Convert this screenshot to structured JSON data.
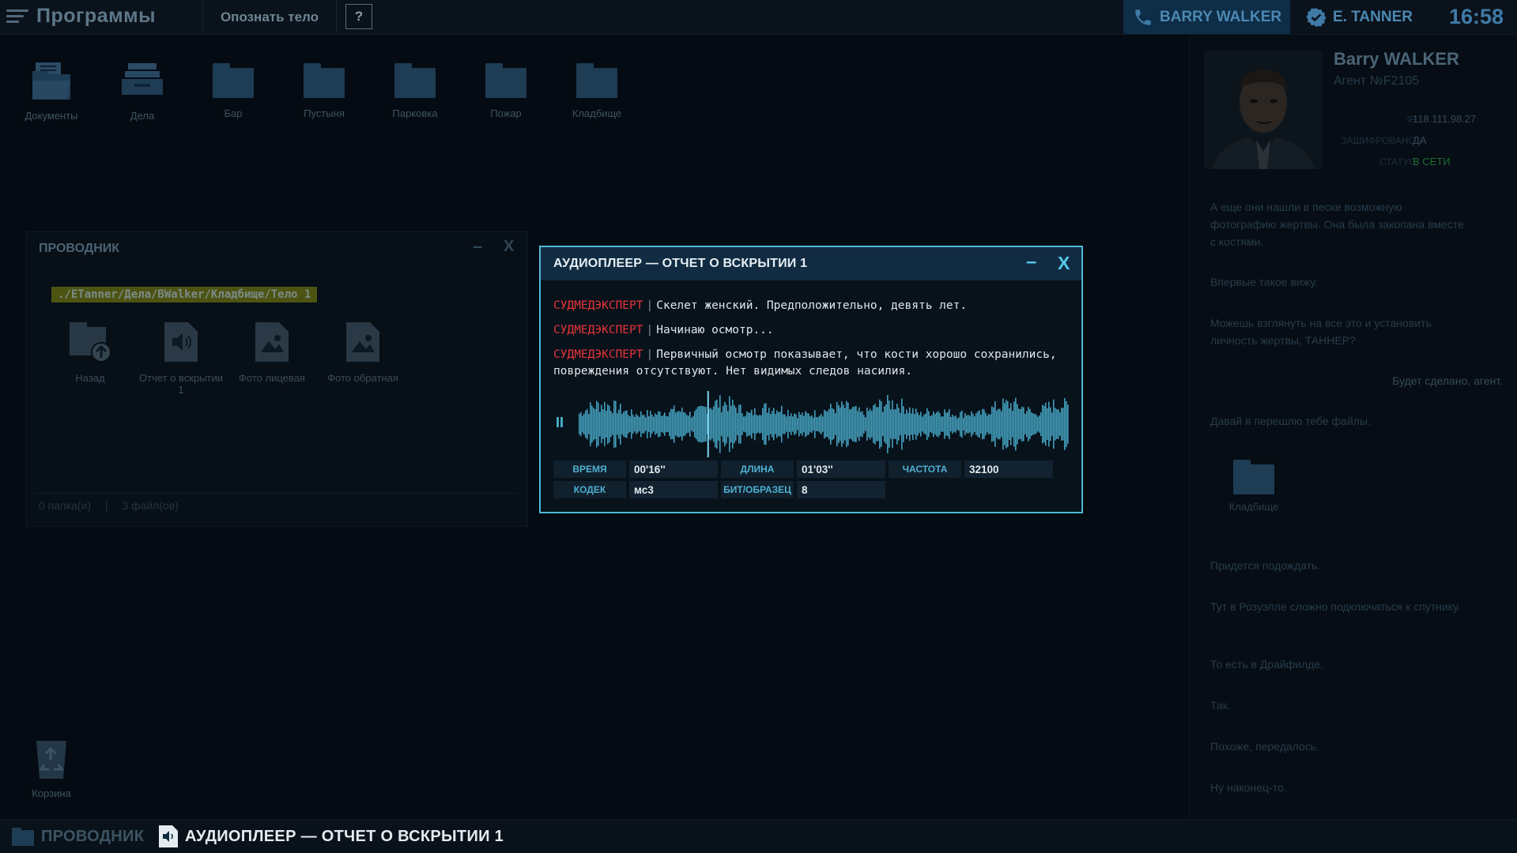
{
  "topbar": {
    "programs": "Программы",
    "identify_tab": "Опознать тело",
    "help": "?",
    "call_name": "BARRY WALKER",
    "agent_name": "E. TANNER",
    "clock": "16:58"
  },
  "desktop": {
    "icons": [
      {
        "label": "Документы",
        "icon": "open-folder-icon"
      },
      {
        "label": "Дела",
        "icon": "file-tray-icon"
      },
      {
        "label": "Бар",
        "icon": "folder-icon"
      },
      {
        "label": "Пустыня",
        "icon": "folder-icon"
      },
      {
        "label": "Парковка",
        "icon": "folder-icon"
      },
      {
        "label": "Пожар",
        "icon": "folder-icon"
      },
      {
        "label": "Кладбище",
        "icon": "folder-icon"
      }
    ],
    "trash": "Корзина"
  },
  "explorer": {
    "title": "ПРОВОДНИК",
    "minimize": "–",
    "close": "X",
    "path": "./ETanner/Дела/BWalker/Кладбище/Тело 1",
    "items": [
      {
        "label": "Назад",
        "icon": "back-folder-icon"
      },
      {
        "label": "Отчет о вскрытии 1",
        "icon": "audio-file-icon"
      },
      {
        "label": "Фото лицевая",
        "icon": "image-file-icon"
      },
      {
        "label": "Фото обратная",
        "icon": "image-file-icon"
      }
    ],
    "status_folders": "0 папка(и)",
    "status_sep": "|",
    "status_files": "3 файл(ов)"
  },
  "player": {
    "title": "АУДИОПЛЕЕР — ОТЧЕТ О ВСКРЫТИИ 1",
    "minimize": "–",
    "close": "X",
    "transcript": [
      {
        "speaker": "СУДМЕДЭКСПЕРТ",
        "text": "Скелет женский. Предположительно, девять лет."
      },
      {
        "speaker": "СУДМЕДЭКСПЕРТ",
        "text": "Начинаю осмотр..."
      },
      {
        "speaker": "СУДМЕДЭКСПЕРТ",
        "text": "Первичный осмотр показывает, что кости хорошо сохранились, повреждения отсутствуют. Нет видимых следов насилия."
      }
    ],
    "separator": "|",
    "pause_symbol": "II",
    "playback_position": 0.264,
    "meta": {
      "time_label": "ВРЕМЯ",
      "time_value": "00'16''",
      "length_label": "ДЛИНА",
      "length_value": "01'03''",
      "freq_label": "ЧАСТОТА",
      "freq_value": "32100",
      "codec_label": "КОДЕК",
      "codec_value": "мс3",
      "bits_label": "БИТ/ОБРАЗЕЦ",
      "bits_value": "8"
    },
    "accent_color": "#4fb9d8",
    "speaker_color": "#e8343a"
  },
  "contact": {
    "name": "Barry WALKER",
    "agent_number": "Агент №F2105",
    "info": [
      {
        "key": "IP",
        "value": "118.111.98.27"
      },
      {
        "key": "ЗАШИФРОВАНО",
        "value": "ДА"
      },
      {
        "key": "СТАТУС",
        "value": "В СЕТИ"
      }
    ],
    "messages": [
      {
        "from": "them",
        "text": "А еще они нашли в песке возможную фотографию жертвы. Она была закопана вместе с костями."
      },
      {
        "from": "them",
        "text": "Впервые такое вижу."
      },
      {
        "from": "them",
        "text": "Можешь взглянуть на все это и установить личность жертвы, ТАННЕР?"
      },
      {
        "from": "me",
        "text": "Будет сделано, агент."
      },
      {
        "from": "them",
        "text": "Давай я перешлю тебе файлы."
      },
      {
        "from": "them",
        "text": "Придется подождать."
      },
      {
        "from": "them",
        "text": "Тут в Розуэлле сложно подключаться к спутнику."
      },
      {
        "from": "them",
        "text": "То есть в Драйфилде."
      },
      {
        "from": "them",
        "text": "Так."
      },
      {
        "from": "them",
        "text": "Похоже, передалось."
      },
      {
        "from": "them",
        "text": "Ну наконец-то."
      }
    ],
    "attachment": "Кладбище",
    "status_online_color": "#2f7f3a"
  },
  "taskbar": {
    "explorer": "ПРОВОДНИК",
    "player": "АУДИОПЛЕЕР — ОТЧЕТ О ВСКРЫТИИ 1"
  }
}
